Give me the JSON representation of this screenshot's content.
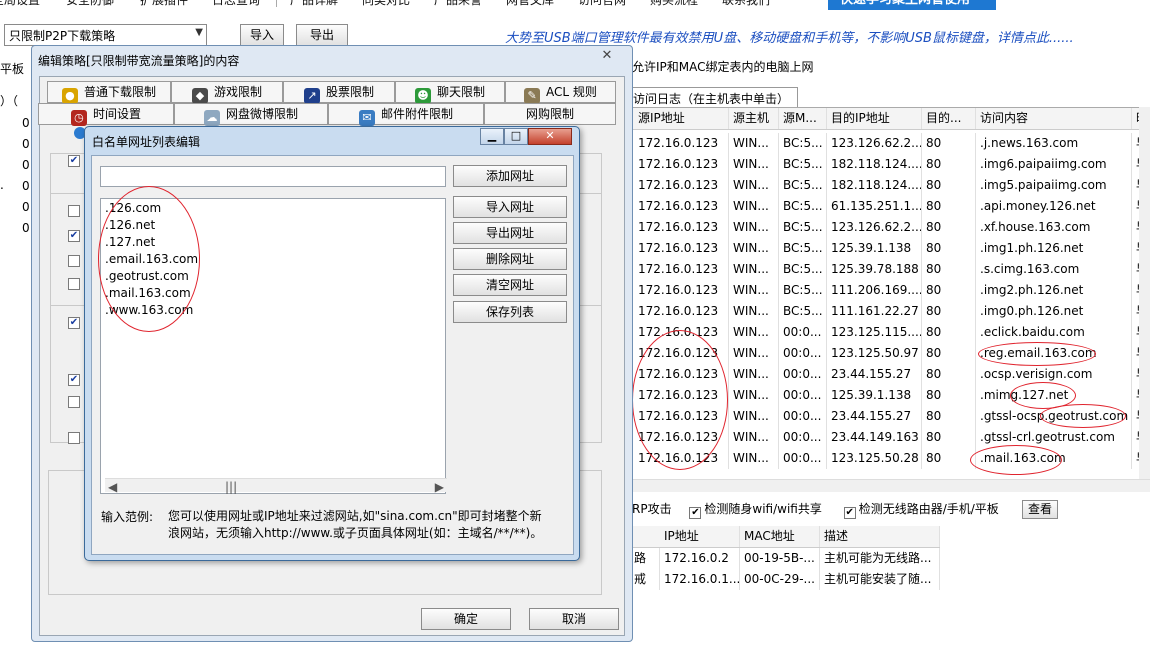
{
  "top_menu": {
    "items": [
      "全局设置",
      "安全防御",
      "扩展插件",
      "日志查询",
      "产品详解",
      "同类对比",
      "产品荣誉",
      "网管文库",
      "访问官网",
      "购买流程",
      "联系我们"
    ],
    "banner": "快速学习聚生网管使用"
  },
  "toolbar": {
    "policy_value": "只限制P2P下载策略",
    "import_label": "导入",
    "export_label": "导出",
    "marquee": "大势至USB端口管理软件最有效禁用U盘、移动硬盘和手机等，不影响USB鼠标键盘，详情点此......"
  },
  "left_strip": {
    "row1": "平板",
    "row2": "）（",
    "zeros": [
      "0",
      "0",
      "0",
      "0",
      "0",
      "0"
    ]
  },
  "background": {
    "info_text": "允许IP和MAC绑定表内的电脑上网",
    "log_tab": "访问日志（在主机表中单击）",
    "columns": [
      "源IP地址",
      "源主机",
      "源M...",
      "目的IP地址",
      "目的...",
      "访问内容",
      "时"
    ],
    "rows": [
      [
        "172.16.0.123",
        "WIN...",
        "BC:5...",
        "123.126.62.2...",
        "80",
        ".j.news.163.com",
        "早"
      ],
      [
        "172.16.0.123",
        "WIN...",
        "BC:5...",
        "182.118.124....",
        "80",
        ".img6.paipaiimg.com",
        "早"
      ],
      [
        "172.16.0.123",
        "WIN...",
        "BC:5...",
        "182.118.124....",
        "80",
        ".img5.paipaiimg.com",
        "早"
      ],
      [
        "172.16.0.123",
        "WIN...",
        "BC:5...",
        "61.135.251.1...",
        "80",
        ".api.money.126.net",
        "早"
      ],
      [
        "172.16.0.123",
        "WIN...",
        "BC:5...",
        "123.126.62.2...",
        "80",
        ".xf.house.163.com",
        "早"
      ],
      [
        "172.16.0.123",
        "WIN...",
        "BC:5...",
        "125.39.1.138",
        "80",
        ".img1.ph.126.net",
        "早"
      ],
      [
        "172.16.0.123",
        "WIN...",
        "BC:5...",
        "125.39.78.188",
        "80",
        ".s.cimg.163.com",
        "早"
      ],
      [
        "172.16.0.123",
        "WIN...",
        "BC:5...",
        "111.206.169....",
        "80",
        ".img2.ph.126.net",
        "早"
      ],
      [
        "172.16.0.123",
        "WIN...",
        "BC:5...",
        "111.161.22.27",
        "80",
        ".img0.ph.126.net",
        "早"
      ],
      [
        "172.16.0.123",
        "WIN...",
        "00:0...",
        "123.125.115....",
        "80",
        ".eclick.baidu.com",
        "早"
      ],
      [
        "172.16.0.123",
        "WIN...",
        "00:0...",
        "123.125.50.97",
        "80",
        ".reg.email.163.com",
        "早"
      ],
      [
        "172.16.0.123",
        "WIN...",
        "00:0...",
        "23.44.155.27",
        "80",
        ".ocsp.verisign.com",
        "早"
      ],
      [
        "172.16.0.123",
        "WIN...",
        "00:0...",
        "125.39.1.138",
        "80",
        ".mimg.127.net",
        "早"
      ],
      [
        "172.16.0.123",
        "WIN...",
        "00:0...",
        "23.44.155.27",
        "80",
        ".gtssl-ocsp.geotrust.com",
        "早"
      ],
      [
        "172.16.0.123",
        "WIN...",
        "00:0...",
        "23.44.149.163",
        "80",
        ".gtssl-crl.geotrust.com",
        "早"
      ],
      [
        "172.16.0.123",
        "WIN...",
        "00:0...",
        "123.125.50.28",
        "80",
        ".mail.163.com",
        "早"
      ]
    ],
    "options": {
      "arp": "RP攻击",
      "wifi": "检测随身wifi/wifi共享",
      "router": "检测无线路由器/手机/平板",
      "view_button": "查看"
    },
    "device_columns": [
      "IP地址",
      "MAC地址",
      "描述"
    ],
    "device_rows": [
      [
        "路",
        "172.16.0.2",
        "00-19-5B-...",
        "主机可能为无线路..."
      ],
      [
        "戒",
        "172.16.0.1...",
        "00-0C-29-...",
        "主机可能安装了随..."
      ]
    ]
  },
  "outer_dialog": {
    "title": "编辑策略[只限制带宽流量策略]的内容",
    "close_glyph": "✕",
    "tabs_row1": [
      "普通下载限制",
      "游戏限制",
      "股票限制",
      "聊天限制",
      "ACL 规则"
    ],
    "tabs_row2": [
      "时间设置",
      "网盘微博限制",
      "邮件附件限制",
      "网购限制"
    ],
    "ok_label": "确定",
    "cancel_label": "取消"
  },
  "inner_dialog": {
    "title": "白名单网址列表编辑",
    "url_input_value": "",
    "urls": [
      ".126.com",
      ".126.net",
      ".127.net",
      ".email.163.com",
      ".geotrust.com",
      ".mail.163.com",
      ".www.163.com"
    ],
    "buttons": {
      "add": "添加网址",
      "import": "导入网址",
      "export": "导出网址",
      "delete": "删除网址",
      "clear": "清空网址",
      "save": "保存列表"
    },
    "hint_label": "输入范例:",
    "hint_text": "您可以使用网址或IP地址来过滤网站,如\"sina.com.cn\"即可封堵整个新浪网站，无须输入http://www.或子页面具体网址(如：主域名/**/**)。"
  }
}
